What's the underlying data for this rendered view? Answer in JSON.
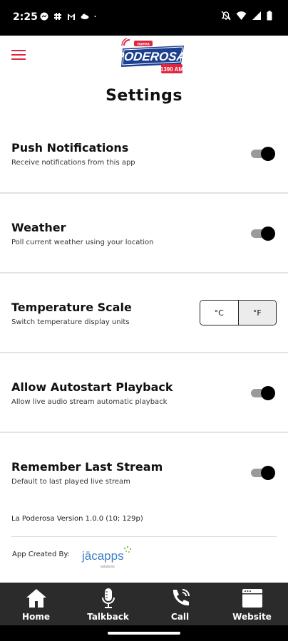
{
  "status_bar": {
    "time": "2:25"
  },
  "header": {
    "logo_top_text": "nueva",
    "logo_text": "PODEROSA",
    "logo_badge": "1390 AM"
  },
  "page_title": "Settings",
  "settings": [
    {
      "title": "Push Notifications",
      "description": "Receive notifications from this app",
      "control": "toggle",
      "enabled": true
    },
    {
      "title": "Weather",
      "description": "Poll current weather using your location",
      "control": "toggle",
      "enabled": true
    },
    {
      "title": "Temperature Scale",
      "description": "Switch temperature display units",
      "control": "segmented",
      "options": [
        "°C",
        "°F"
      ],
      "selected": "°F"
    },
    {
      "title": "Allow Autostart Playback",
      "description": "Allow live audio stream automatic playback",
      "control": "toggle",
      "enabled": true
    },
    {
      "title": "Remember Last Stream",
      "description": "Default to last played live stream",
      "control": "toggle",
      "enabled": true
    }
  ],
  "version_text": "La Poderosa Version 1.0.0 (10; 129p)",
  "credit": {
    "label": "App Created By:",
    "logo_text": "jācapps",
    "logo_sub": "solutions"
  },
  "bottom_nav": [
    {
      "label": "Home",
      "icon": "home-icon"
    },
    {
      "label": "Talkback",
      "icon": "microphone-icon"
    },
    {
      "label": "Call",
      "icon": "phone-icon"
    },
    {
      "label": "Website",
      "icon": "browser-window-icon"
    }
  ],
  "colors": {
    "accent": "#e0263f",
    "brand_blue": "#1d3f8f",
    "nav_bg": "#2b2b2b"
  }
}
